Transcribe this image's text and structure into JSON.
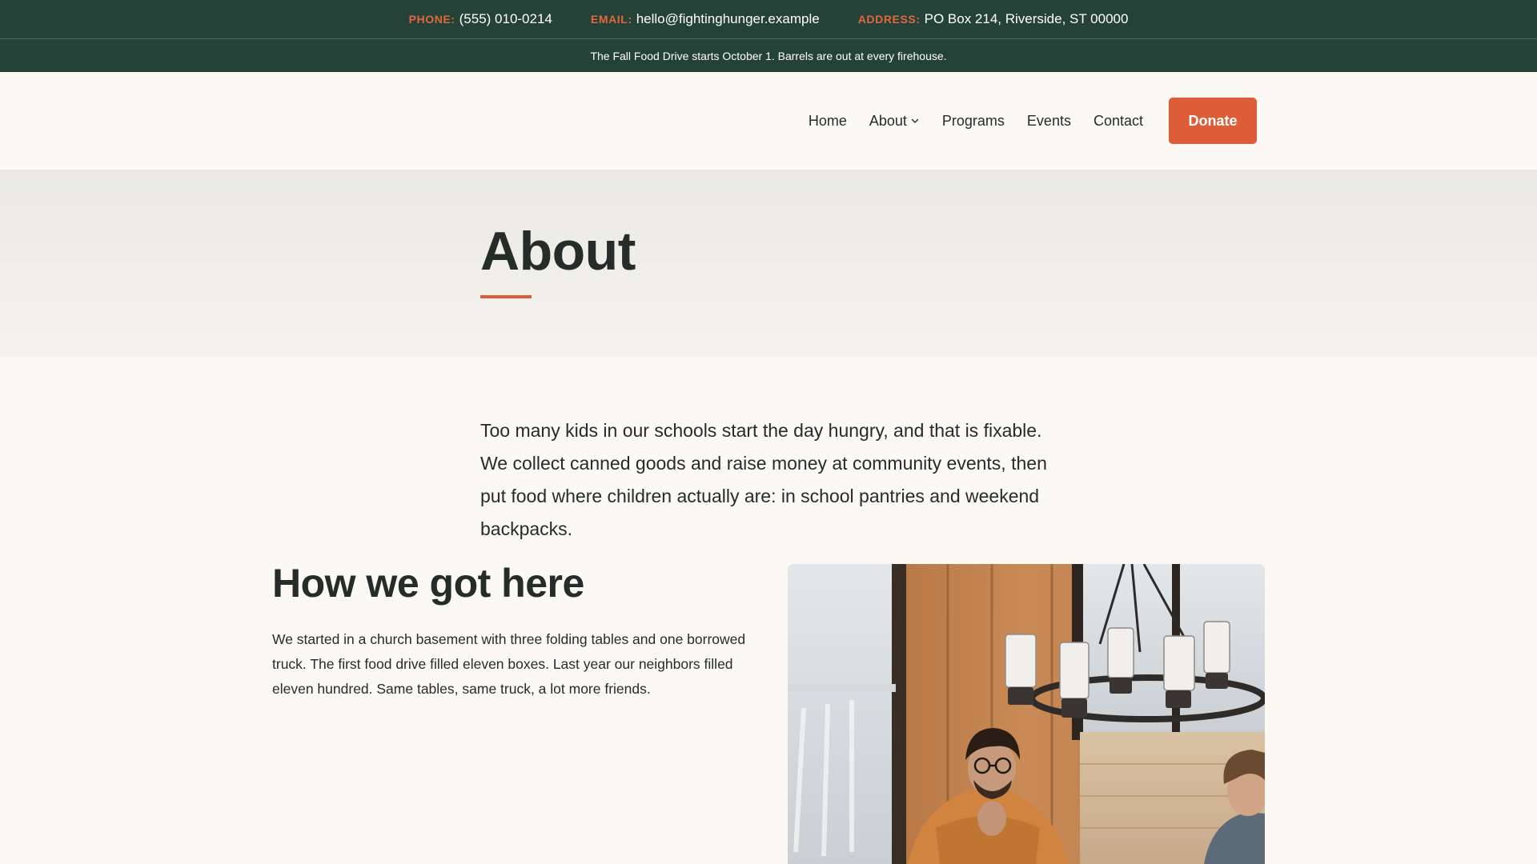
{
  "contact": {
    "phone_label": "PHONE:",
    "phone": "(555) 010-0214",
    "email_label": "EMAIL:",
    "email": "hello@fightinghunger.example",
    "address_label": "ADDRESS:",
    "address": "PO Box 214, Riverside, ST 00000"
  },
  "announcement": "The Fall Food Drive starts October 1. Barrels are out at every firehouse.",
  "nav": {
    "items": [
      {
        "label": "Home"
      },
      {
        "label": "About",
        "has_dropdown": true
      },
      {
        "label": "Programs"
      },
      {
        "label": "Events"
      },
      {
        "label": "Contact"
      }
    ],
    "donate_label": "Donate"
  },
  "page": {
    "title": "About",
    "intro": "Too many kids in our schools start the day hungry, and that is fixable. We collect canned goods and raise money at community events, then put food where children actually are: in school pantries and weekend backpacks."
  },
  "history": {
    "heading": "How we got here",
    "text": "We started in a church basement with three folding tables and one borrowed truck. The first food drive filled eleven boxes. Last year our neighbors filled eleven hundred. Same tables, same truck, a lot more friends."
  },
  "colors": {
    "topbar": "#244237",
    "accent": "#dc5d38",
    "background": "#fcf9f4",
    "text": "#252c29"
  }
}
